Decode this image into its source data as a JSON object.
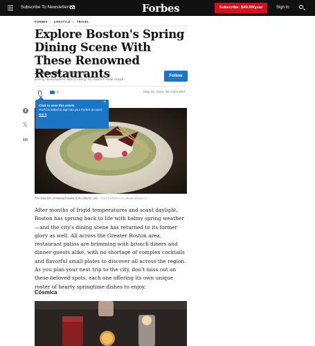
{
  "topbar": {
    "newsletter_label": "Subscribe To Newsletters",
    "logo": "Forbes",
    "subscribe_label": "Subscribe: $49.99/year",
    "signin_label": "Sign In"
  },
  "breadcrumb": [
    "FORBES",
    "LIFESTYLE",
    "TRAVEL"
  ],
  "article": {
    "headline": "Explore Boston's Spring Dining Scene With These Renowned Restaurants",
    "author_name": "Jared Ranahan",
    "author_role": "Contributor",
    "tagline": "Every destination has a story, no matter how small.",
    "follow_label": "Follow",
    "comment_count": "0",
    "date": "May 28, 2024, 05:37pm EDT",
    "caption": "The state fish of Massachusetts is the Atlantic cod.",
    "photo_credit": "PHOTOGRAPHY BY BRIAN SAMUELS",
    "body": "After months of frigid temperatures and scant daylight, Boston has sprung back to life with balmy spring weather—and the city's dining scene has returned to its former glory as well. All across the Greater Boston area, restaurant patios are brimming with brunch diners and dinner guests alike, with no shortage of complex cocktails and flavorful small plates to discover all across the region. As you plan your next trip to the city, don't miss out on these beloved spots, each one offering its own unique roster of hearty springtime dishes to enjoy.",
    "section_title": "Cósmica"
  },
  "tooltip": {
    "title": "Click to save this article.",
    "body": "You'll be asked to sign into your Forbes account.",
    "link": "Got it"
  },
  "colors": {
    "topbar": "#111111",
    "subscribe": "#d40f1f",
    "accent_blue": "#1b76c6"
  },
  "icons": [
    "hamburger-icon",
    "mail-icon",
    "search-icon",
    "bookmark-icon",
    "comment-icon",
    "facebook-icon",
    "x-icon",
    "linkedin-icon",
    "close-icon",
    "info-icon"
  ]
}
